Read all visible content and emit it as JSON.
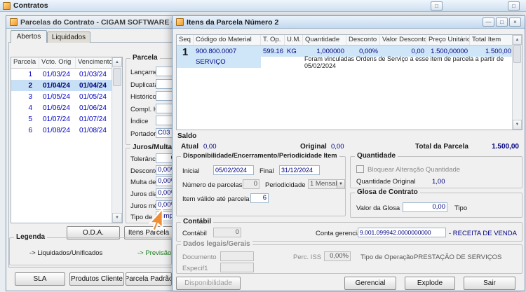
{
  "icons": {
    "minimize": "—",
    "maximize": "□",
    "close": "×",
    "scroll_up": "▲",
    "scroll_down": "▼",
    "dropdown": "▼"
  },
  "colors": {
    "selection_bg": "#cfe6f8",
    "value_text": "#000080",
    "grid_link_text": "#0000c0",
    "legend_green": "#1e7d1e",
    "cursor_orange": "#ef8d33",
    "titlebar_active": "#c3d9ef",
    "disabled_text": "#8a8a8a"
  },
  "mdi": {
    "title": "Contratos"
  },
  "parcelas": {
    "title": "Parcelas do Contrato - CIGAM SOFTWARE CORPORATIVO LTDA",
    "tabs": {
      "abertos": "Abertos",
      "liquidados": "Liquidados"
    },
    "grid": {
      "columns": [
        "Parcela",
        "Vcto. Orig",
        "Vencimento"
      ],
      "rows": [
        {
          "n": "1",
          "vcto": "01/03/24",
          "venc": "01/03/24"
        },
        {
          "n": "2",
          "vcto": "01/04/24",
          "venc": "01/04/24"
        },
        {
          "n": "3",
          "vcto": "01/05/24",
          "venc": "01/05/24"
        },
        {
          "n": "4",
          "vcto": "01/06/24",
          "venc": "01/06/24"
        },
        {
          "n": "5",
          "vcto": "01/07/24",
          "venc": "01/07/24"
        },
        {
          "n": "6",
          "vcto": "01/08/24",
          "venc": "01/08/24"
        }
      ],
      "selected_row": 2
    },
    "parcela_group": {
      "title": "Parcela",
      "lancamento": "Lançamento",
      "duplicata": "Duplicata",
      "historico": "Histórico",
      "compl_historico": "Compl. Histórico",
      "indice": "Índice",
      "portador": "Portador",
      "portador_value": "C03"
    },
    "juros_group": {
      "title": "Juros/Multa/Glosa",
      "tolerancia": "Tolerância",
      "tolerancia_value": "0",
      "desconto": "Desconto de",
      "desconto_value": "0,00%",
      "multa": "Multa de",
      "multa_value": "0,00%",
      "juros_dia": "Juros dia de",
      "juros_dia_value": "0,00%",
      "juros_mes": "Juros mês de",
      "juros_mes_value": "0,00%",
      "tipo_juros": "Tipo de Juros",
      "tipo_juros_value": "Simples"
    },
    "oda_button": "O.D.A.",
    "itens_parcela_button": "Itens Parcela",
    "legenda": {
      "title": "Legenda",
      "liquidados": "-> Liquidados/Unificados",
      "previsao": "-> Previsão"
    },
    "sla_button": "SLA",
    "produtos_button": "Produtos Cliente",
    "padrao_button": "Parcela Padrão"
  },
  "itens": {
    "title": "Itens da Parcela Número 2",
    "grid": {
      "columns": [
        "Seq",
        "Código do Material",
        "T. Op.",
        "U.M.",
        "Quantidade",
        "Desconto",
        "Valor Desconto",
        "Preço Unitário",
        "Total Item"
      ],
      "row": {
        "seq": "1",
        "codigo": "900.800.0007",
        "t_op": "599.16",
        "um": "KG",
        "quantidade": "1,000000",
        "desconto": "0,00%",
        "valor_desconto": "0,00",
        "preco_unitario": "1.500,00000",
        "total_item": "1.500,00",
        "descricao": "SERVIÇO",
        "mensagem": "Foram vinculadas Ordens de Serviço a esse item de parcela a partir de 05/02/2024"
      }
    },
    "saldo": {
      "title": "Saldo",
      "atual_label": "Atual",
      "atual": "0,00",
      "original_label": "Original",
      "original": "0,00",
      "total_label": "Total da Parcela",
      "total": "1.500,00"
    },
    "disponibilidade": {
      "title": "Disponibilidade/Encerramento/Periodicidade Item",
      "inicial_label": "Inicial",
      "inicial": "05/02/2024",
      "final_label": "Final",
      "final": "31/12/2024",
      "num_parcelas_label": "Número de parcelas",
      "num_parcelas": "0",
      "periodicidade_label": "Periodicidade",
      "periodicidade": "1 Mensal",
      "item_valido_label": "Item válido até parcela",
      "item_valido": "6"
    },
    "quantidade": {
      "title": "Quantidade",
      "bloquear_label": "Bloquear Alteração Quantidade",
      "original_label": "Quantidade Original",
      "original": "1,00"
    },
    "glosa": {
      "title": "Glosa de Contrato",
      "valor_label": "Valor da Glosa",
      "valor": "0,00",
      "tipo_label": "Tipo"
    },
    "contabil": {
      "title": "Contábil",
      "contabil_label": "Contábil",
      "contabil": "0",
      "conta_label": "Conta gerencial",
      "conta": "9.001.099942.0000000000",
      "conta_desc": "- RECEITA DE VENDA"
    },
    "dados": {
      "title": "Dados legais/Gerais",
      "documento_label": "Documento",
      "documento": "",
      "perc_iss_label": "Perc. ISS",
      "perc_iss": "0,00%",
      "tipo_op_label": "Tipo de Operação",
      "tipo_op": "PRESTAÇÃO DE SERVIÇOS",
      "especif1_label": "Especif1",
      "especif1": ""
    },
    "disponibilidade_button": "Disponibilidade",
    "gerencial_button": "Gerencial",
    "explode_button": "Explode",
    "sair_button": "Sair"
  }
}
